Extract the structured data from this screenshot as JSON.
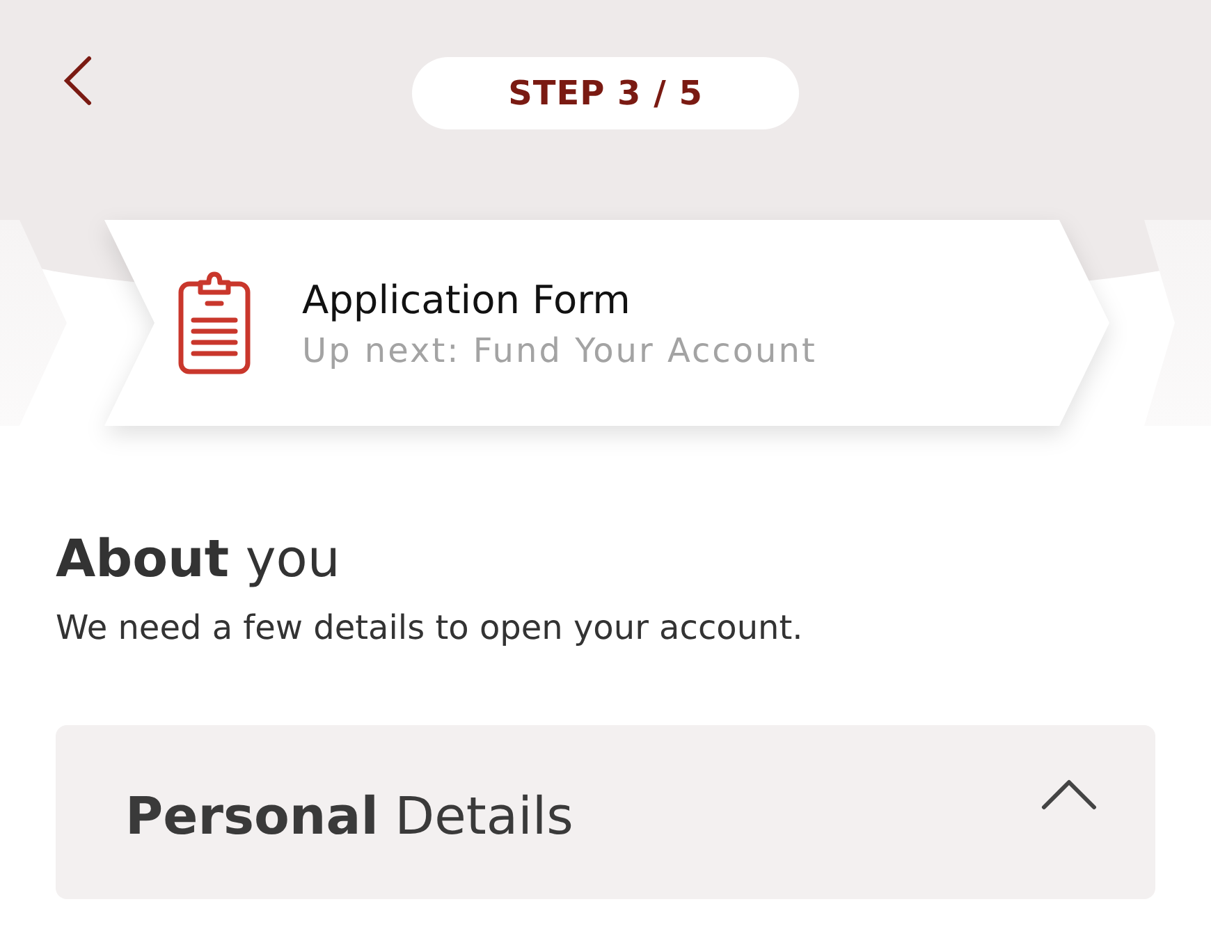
{
  "step": {
    "label": "STEP 3 / 5"
  },
  "banner": {
    "title": "Application Form",
    "subtitle": "Up next: Fund Your Account"
  },
  "section": {
    "heading": "**About** you",
    "description": "We need a few details to open your account."
  },
  "accordion": {
    "title": "**Personal** Details",
    "expanded": true
  }
}
